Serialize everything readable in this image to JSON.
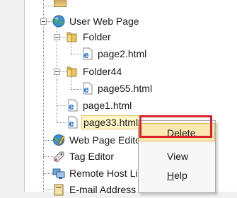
{
  "tree": {
    "items": [
      {
        "label": "User Web Page",
        "icon": "globe-icon"
      },
      {
        "label": "Folder",
        "icon": "folder-icon"
      },
      {
        "label": "page2.html",
        "icon": "html-file-icon"
      },
      {
        "label": "Folder44",
        "icon": "folder-icon"
      },
      {
        "label": "page55.html",
        "icon": "html-file-icon"
      },
      {
        "label": "page1.html",
        "icon": "html-file-icon"
      },
      {
        "label": "page33.html",
        "icon": "html-file-icon",
        "selected": true
      },
      {
        "label": "Web Page Editor",
        "icon": "web-editor-icon"
      },
      {
        "label": "Tag Editor",
        "icon": "tag-icon"
      },
      {
        "label": "Remote Host List",
        "icon": "remote-host-icon"
      },
      {
        "label": "E-mail Address Book",
        "icon": "address-book-icon"
      }
    ]
  },
  "context_menu": {
    "items": [
      {
        "label": "Delete",
        "hotkey_letter": "D",
        "rest": "elete",
        "highlighted": true
      },
      {
        "label": "View"
      },
      {
        "label": "Help",
        "hotkey_letter": "H",
        "rest": "elp"
      }
    ]
  },
  "colors": {
    "highlight_outline": "#d9232b",
    "menu_hover": "#fbe8b0",
    "selection": "#fff6c8"
  }
}
